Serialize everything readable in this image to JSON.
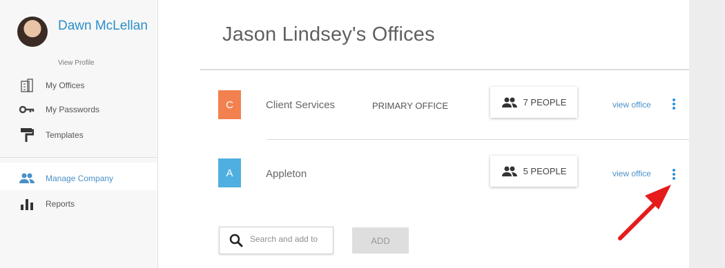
{
  "top_strip": {
    "text": ") ••••••••••••••• ( ••••••• )"
  },
  "sidebar": {
    "user": {
      "name": "Dawn McLellan",
      "view_profile": "View Profile"
    },
    "nav_primary": [
      {
        "label": "My Offices",
        "icon": "offices-icon"
      },
      {
        "label": "My Passwords",
        "icon": "key-icon"
      },
      {
        "label": "Templates",
        "icon": "paint-roller-icon"
      }
    ],
    "nav_secondary": [
      {
        "label": "Manage Company",
        "icon": "people-icon",
        "active": true
      },
      {
        "label": "Reports",
        "icon": "bar-chart-icon"
      }
    ]
  },
  "main": {
    "title": "Jason Lindsey's Offices",
    "offices": [
      {
        "initial": "C",
        "name": "Client Services",
        "tag": "PRIMARY OFFICE",
        "people": "7 PEOPLE",
        "view_link": "view office",
        "color": "#f2814f"
      },
      {
        "initial": "A",
        "name": "Appleton",
        "tag": "",
        "people": "5 PEOPLE",
        "view_link": "view office",
        "color": "#4fb0e0"
      }
    ],
    "search": {
      "placeholder": "Search and add to"
    },
    "add_label": "ADD"
  },
  "colors": {
    "accent": "#4a90c8",
    "arrow": "#e61b1b"
  }
}
